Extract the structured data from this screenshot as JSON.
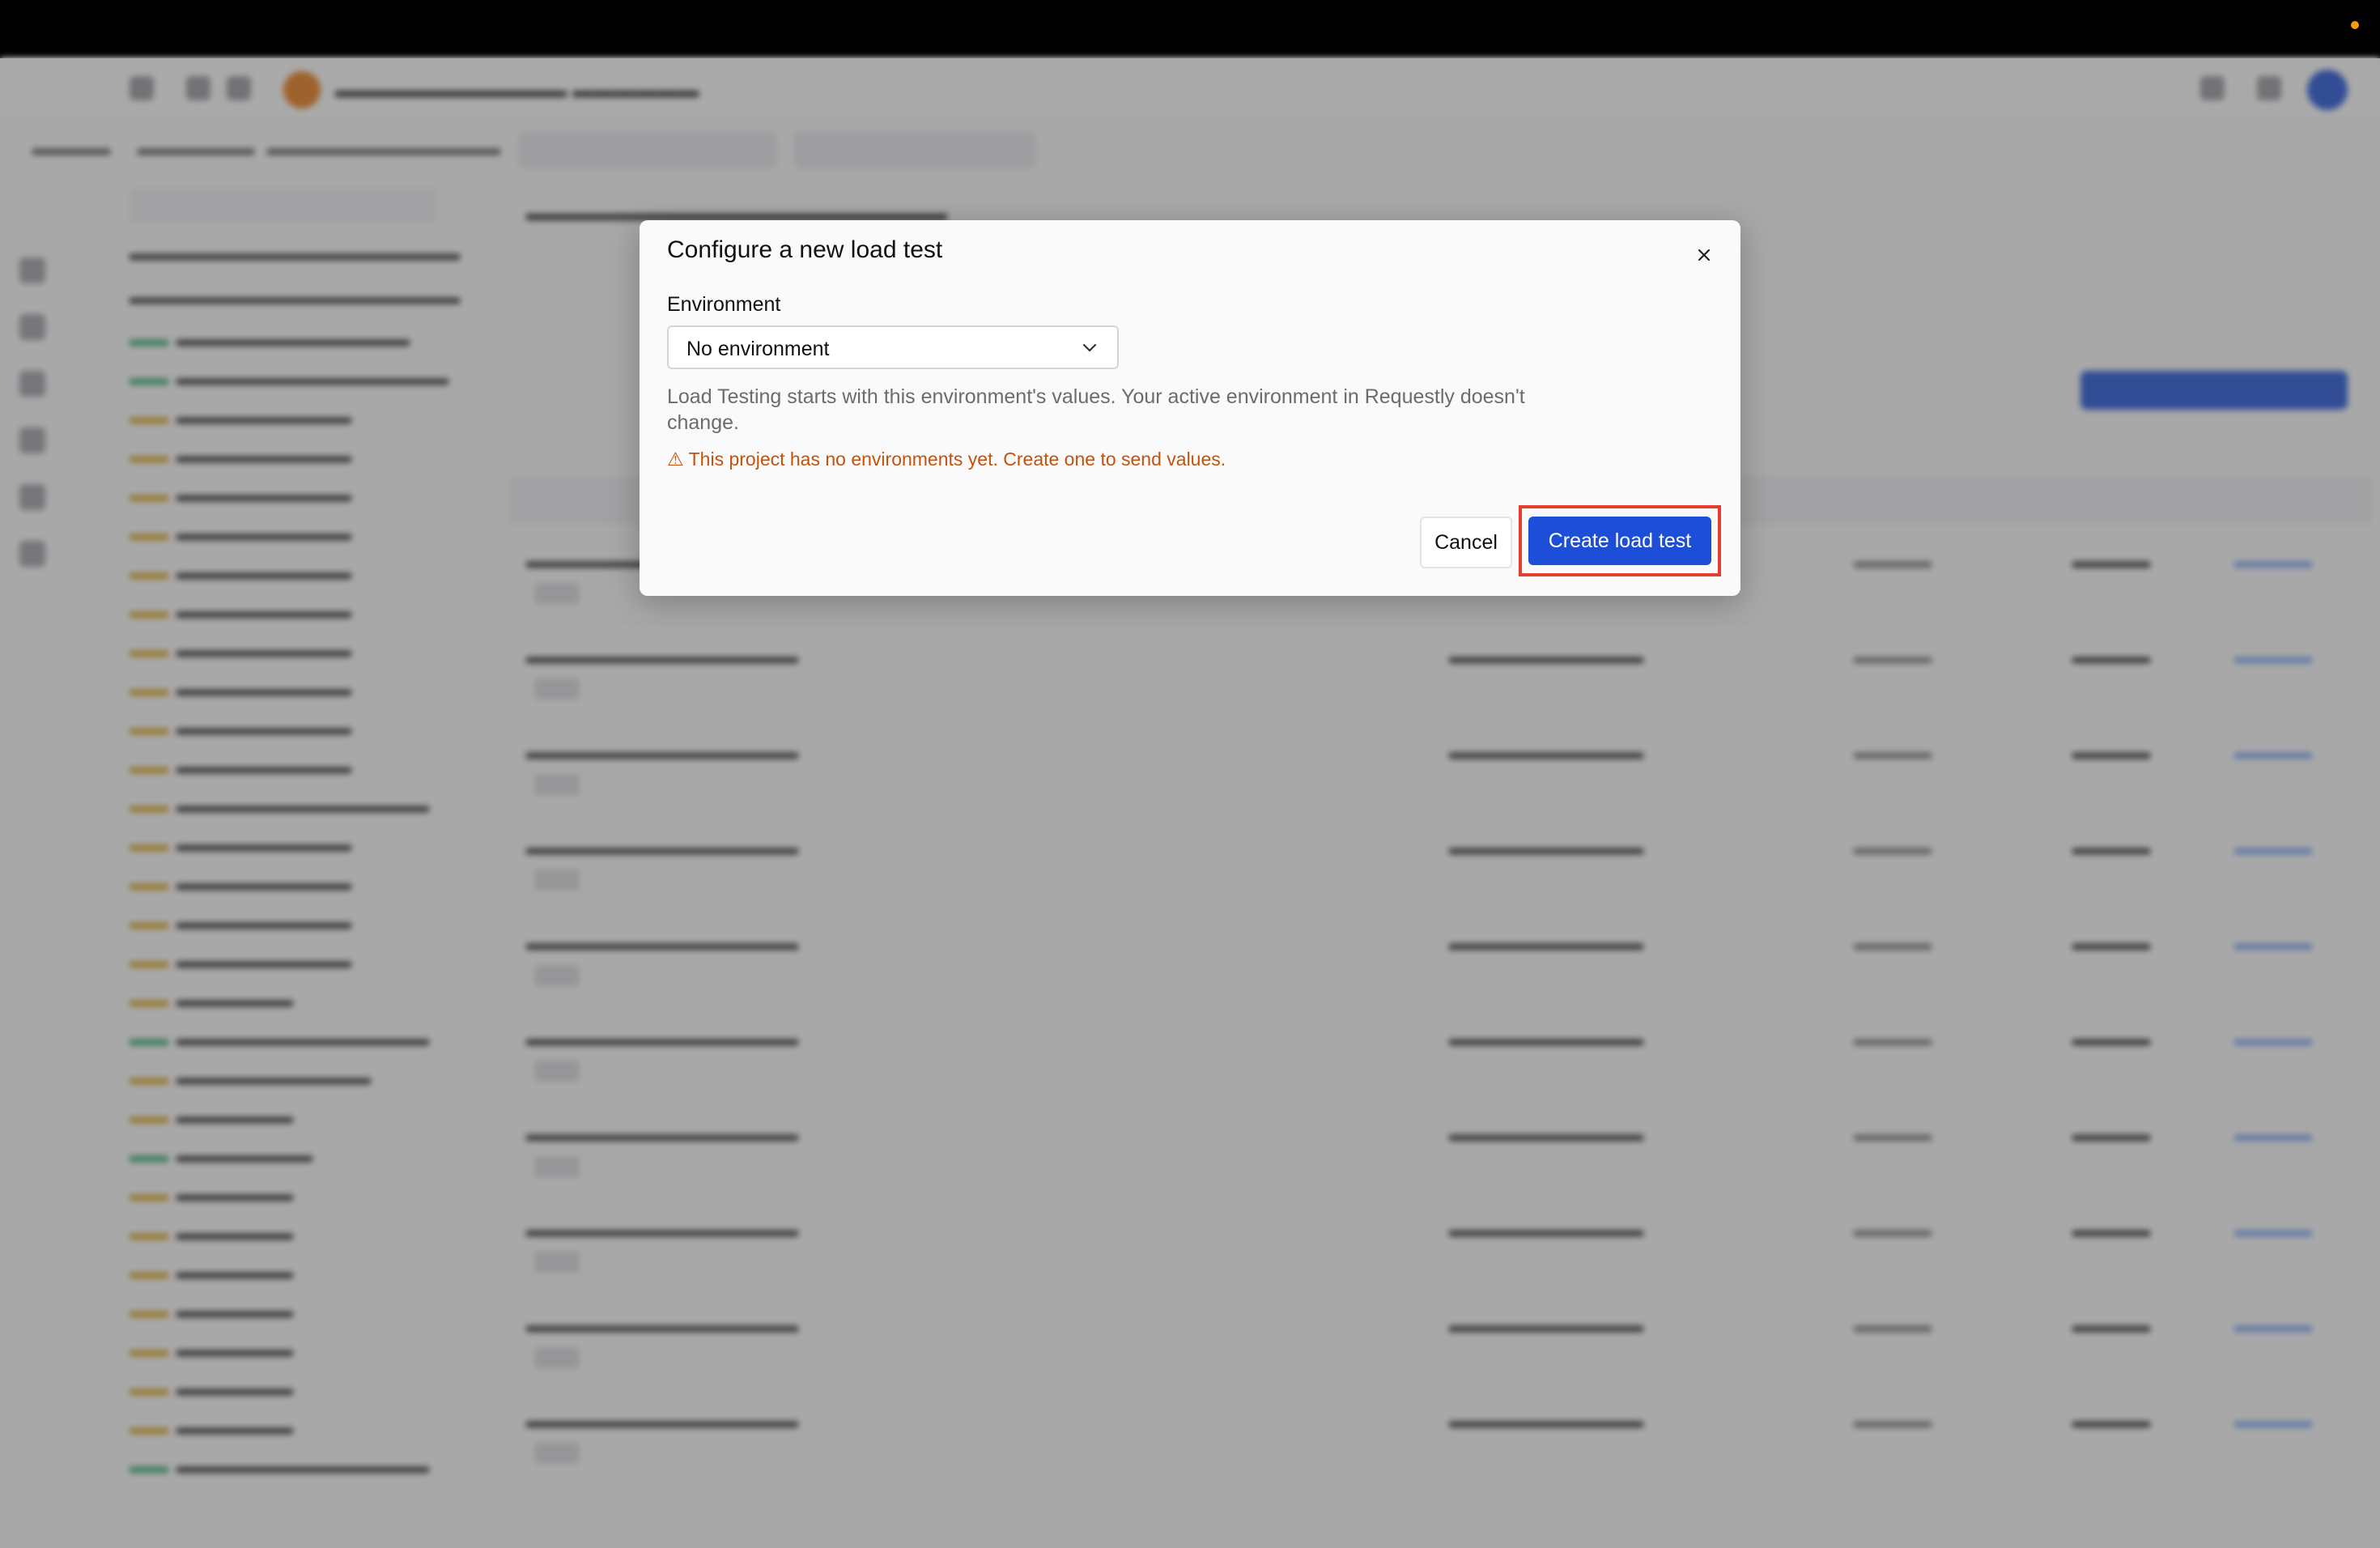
{
  "modal": {
    "title": "Configure a new load test",
    "environment_label": "Environment",
    "environment_value": "No environment",
    "help_text": "Load Testing starts with this environment's values. Your active environment in Requestly doesn't change.",
    "warning_icon": "⚠",
    "warning_text": "This project has no environments yet. Create one to send values.",
    "cancel_label": "Cancel",
    "create_label": "Create load test"
  },
  "colors": {
    "primary_button": "#1d4ed8",
    "highlight_border": "#e53e2e",
    "warning_text": "#c2530f"
  },
  "icons": {
    "close": "close-icon",
    "dropdown": "chevron-down-icon",
    "warning": "warning-icon"
  }
}
